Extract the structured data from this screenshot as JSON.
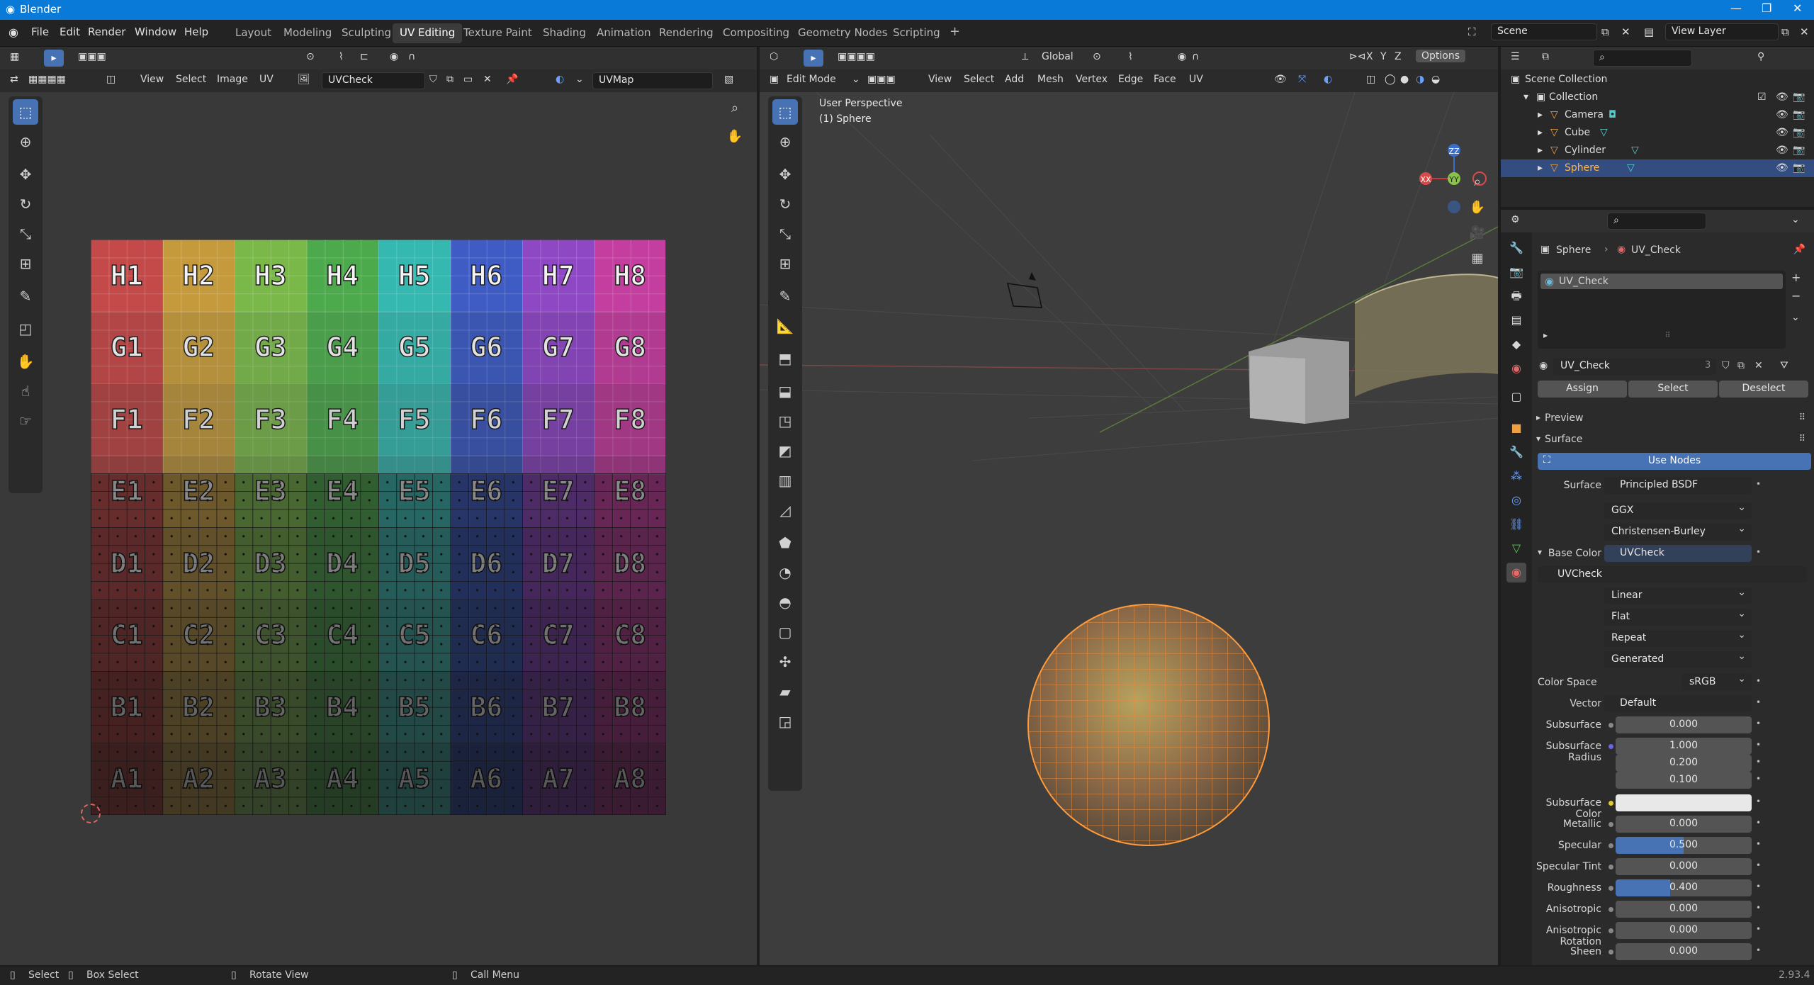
{
  "app": {
    "title": "Blender",
    "version": "2.93.4"
  },
  "menu": [
    "File",
    "Edit",
    "Render",
    "Window",
    "Help"
  ],
  "workspaces": [
    "Layout",
    "Modeling",
    "Sculpting",
    "UV Editing",
    "Texture Paint",
    "Shading",
    "Animation",
    "Rendering",
    "Compositing",
    "Geometry Nodes",
    "Scripting"
  ],
  "active_workspace": "UV Editing",
  "scene": {
    "name": "Scene",
    "view_layer": "View Layer"
  },
  "uv_editor": {
    "menus": [
      "View",
      "Select",
      "Image",
      "UV"
    ],
    "image_name": "UVCheck",
    "uv_map": "UVMap",
    "grid_rows": [
      [
        "H1",
        "H2",
        "H3",
        "H4",
        "H5",
        "H6",
        "H7",
        "H8"
      ],
      [
        "G1",
        "G2",
        "G3",
        "G4",
        "G5",
        "G6",
        "G7",
        "G8"
      ],
      [
        "F1",
        "F2",
        "F3",
        "F4",
        "F5",
        "F6",
        "F7",
        "F8"
      ],
      [
        "E1",
        "E2",
        "E3",
        "E4",
        "E5",
        "E6",
        "E7",
        "E8"
      ],
      [
        "D1",
        "D2",
        "D3",
        "D4",
        "D5",
        "D6",
        "D7",
        "D8"
      ],
      [
        "C1",
        "C2",
        "C3",
        "C4",
        "C5",
        "C6",
        "C7",
        "C8"
      ],
      [
        "B1",
        "B2",
        "B3",
        "B4",
        "B5",
        "B6",
        "B7",
        "B8"
      ],
      [
        "A1",
        "A2",
        "A3",
        "A4",
        "A5",
        "A6",
        "A7",
        "A8"
      ]
    ],
    "column_colors": [
      "#c44a4a",
      "#c49a3c",
      "#7ab84a",
      "#4caa4c",
      "#34b8b0",
      "#3e5cc4",
      "#8e48c4",
      "#c43ea0"
    ]
  },
  "viewport": {
    "mode": "Edit Mode",
    "orientation": "Global",
    "options_label": "Options",
    "menus": [
      "View",
      "Select",
      "Add",
      "Mesh",
      "Vertex",
      "Edge",
      "Face",
      "UV"
    ],
    "overlay_title": "User Perspective",
    "overlay_object": "(1) Sphere",
    "gizmo_axes": [
      "X",
      "Y",
      "Z"
    ]
  },
  "outliner": {
    "root": "Scene Collection",
    "collection": "Collection",
    "items": [
      "Camera",
      "Cube",
      "Cylinder",
      "Sphere"
    ],
    "selected": "Sphere"
  },
  "properties": {
    "breadcrumb_object": "Sphere",
    "breadcrumb_material": "UV_Check",
    "slot_name": "UV_Check",
    "material_name": "UV_Check",
    "user_count": "3",
    "buttons": {
      "assign": "Assign",
      "select": "Select",
      "deselect": "Deselect"
    },
    "panels": {
      "preview": "Preview",
      "surface": "Surface"
    },
    "use_nodes": "Use Nodes",
    "rows": {
      "surface": {
        "label": "Surface",
        "value": "Principled BSDF"
      },
      "distribution": "GGX",
      "subsurface_method": "Christensen-Burley",
      "base_color": {
        "label": "Base Color",
        "value": "UVCheck"
      },
      "image_name": "UVCheck",
      "interpolation": "Linear",
      "projection": "Flat",
      "extension": "Repeat",
      "source": "Generated",
      "color_space": {
        "label": "Color Space",
        "value": "sRGB"
      },
      "vector": {
        "label": "Vector",
        "value": "Default"
      },
      "subsurface": {
        "label": "Subsurface",
        "value": "0.000"
      },
      "subsurface_radius": {
        "label": "Subsurface Radius",
        "values": [
          "1.000",
          "0.200",
          "0.100"
        ]
      },
      "subsurface_color": {
        "label": "Subsurface Color"
      },
      "metallic": {
        "label": "Metallic",
        "value": "0.000"
      },
      "specular": {
        "label": "Specular",
        "value": "0.500",
        "fill": 0.5
      },
      "specular_tint": {
        "label": "Specular Tint",
        "value": "0.000"
      },
      "roughness": {
        "label": "Roughness",
        "value": "0.400",
        "fill": 0.4
      },
      "anisotropic": {
        "label": "Anisotropic",
        "value": "0.000"
      },
      "anisotropic_rotation": {
        "label": "Anisotropic Rotation",
        "value": "0.000"
      },
      "sheen": {
        "label": "Sheen",
        "value": "0.000"
      }
    }
  },
  "statusbar": {
    "select": "Select",
    "box_select": "Box Select",
    "rotate_view": "Rotate View",
    "call_menu": "Call Menu"
  }
}
